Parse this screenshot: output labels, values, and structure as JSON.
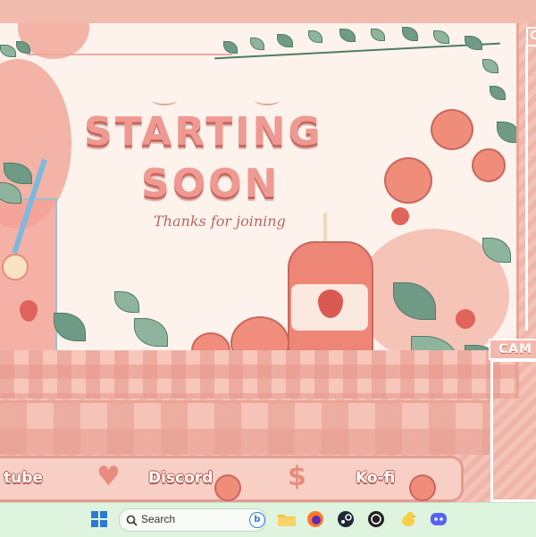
{
  "scene": {
    "title_line1": "STARTING",
    "title_line2": "SOON",
    "subtitle": "Thanks for joining"
  },
  "panels": {
    "cam_label": "CAM",
    "top_cam_label": "C"
  },
  "social": {
    "items": [
      {
        "label": "tube",
        "icon": "heart-icon"
      },
      {
        "label": "Discord",
        "icon": "heart-icon"
      },
      {
        "label": "Ko-fi",
        "icon": "dollar-icon"
      }
    ],
    "heart_symbol": "♥",
    "dollar_symbol": "$"
  },
  "taskbar": {
    "search_placeholder": "Search",
    "icons": [
      "windows-start-icon",
      "search-icon",
      "bing-icon",
      "file-explorer-icon",
      "firefox-icon",
      "steam-icon",
      "obs-icon",
      "chicken-app-icon",
      "discord-icon"
    ]
  },
  "colors": {
    "accent": "#ee9a93",
    "accent_dark": "#c9675d",
    "taskbar_bg": "#dff4df",
    "leaf": "#6e9a86"
  }
}
